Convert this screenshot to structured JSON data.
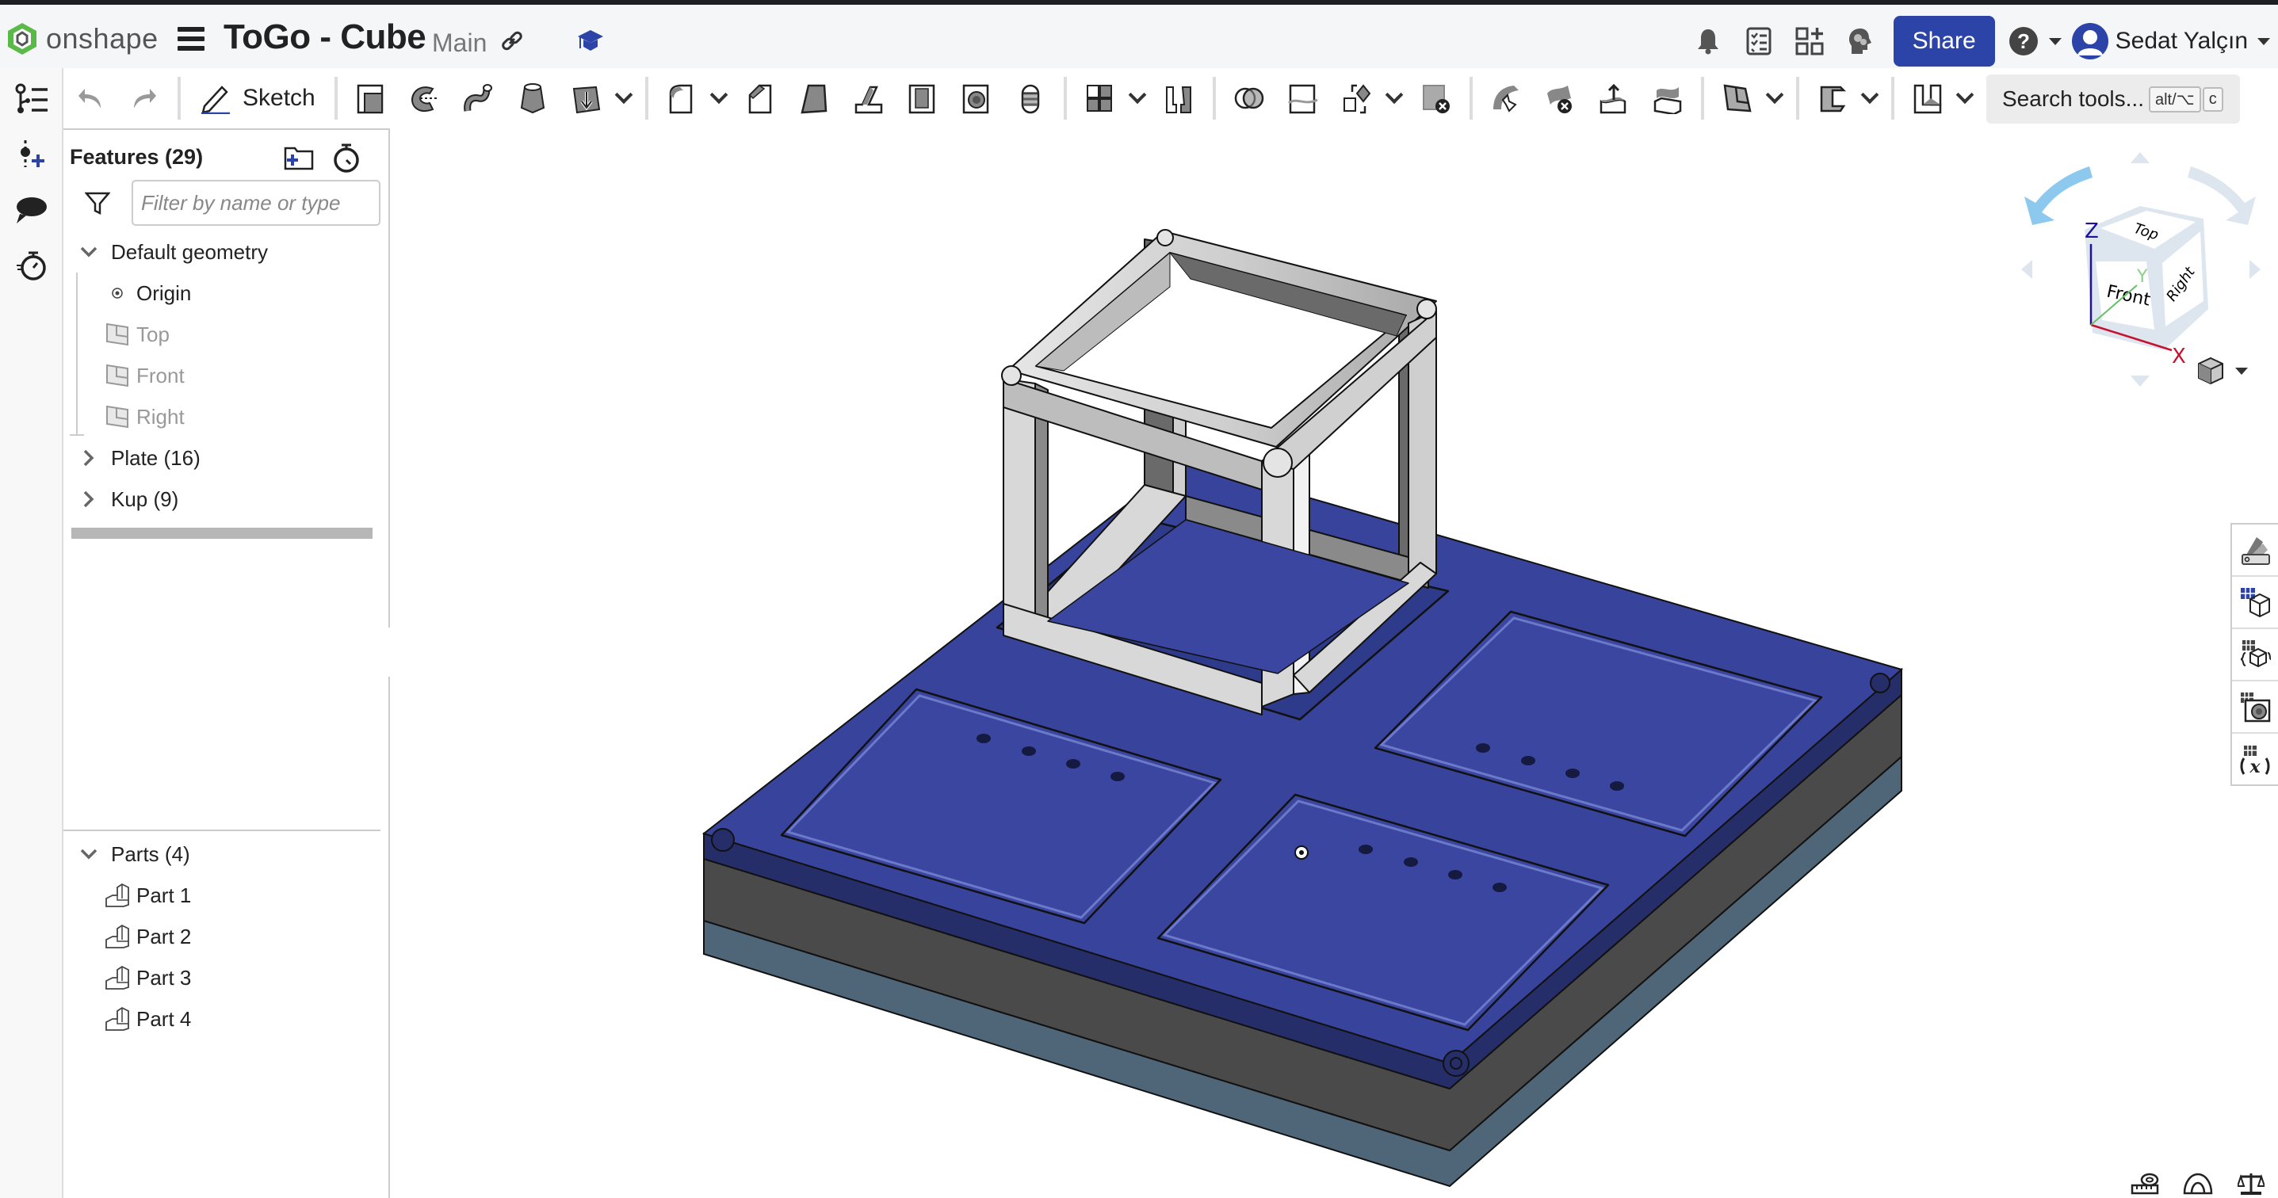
{
  "app": {
    "logo_text": "onshape",
    "doc_title": "ToGo - Cube",
    "branch": "Main"
  },
  "header": {
    "icons": [
      "link-icon",
      "education-icon",
      "notifications-icon",
      "tasks-icon",
      "app-store-icon",
      "learning-center-icon"
    ],
    "share_label": "Share",
    "help_icon": "help-icon",
    "user_name": "Sedat Yalçın"
  },
  "toolbar": {
    "sketch_label": "Sketch",
    "search_label": "Search tools...",
    "search_kbd_1": "alt/⌥",
    "search_kbd_2": "c",
    "tools": [
      "undo",
      "redo",
      "sketch",
      "extrude",
      "revolve",
      "sweep",
      "loft",
      "thicken",
      "fillet",
      "chamfer",
      "draft",
      "rib",
      "shell",
      "hole",
      "thread",
      "linear-pattern",
      "mirror",
      "boolean",
      "split",
      "transform",
      "delete-part",
      "move-face",
      "delete-face",
      "extend-surface",
      "offset-surface",
      "plane",
      "sheet-metal",
      "frame",
      "add-custom-feature"
    ]
  },
  "rail": {
    "items": [
      "feature-list",
      "insert-mate-connector",
      "comments",
      "performance"
    ]
  },
  "features_panel": {
    "title": "Features (29)",
    "filter_placeholder": "Filter by name or type",
    "tree": [
      {
        "label": "Default geometry",
        "expanded": true
      },
      {
        "label": "Origin",
        "child": true
      },
      {
        "label": "Top",
        "child": true,
        "hidden": true
      },
      {
        "label": "Front",
        "child": true,
        "hidden": true
      },
      {
        "label": "Right",
        "child": true,
        "hidden": true
      },
      {
        "label": "Plate (16)",
        "expanded": false
      },
      {
        "label": "Kup (9)",
        "expanded": false
      }
    ],
    "parts_title": "Parts (4)",
    "parts": [
      "Part 1",
      "Part 2",
      "Part 3",
      "Part 4"
    ]
  },
  "viewcube": {
    "faces": {
      "top": "Top",
      "front": "Front",
      "right": "Right"
    },
    "axes": {
      "x": "X",
      "y": "Y",
      "z": "Z"
    }
  },
  "right_dock": {
    "items": [
      "appearance-panel",
      "configurations-panel",
      "variable-studio-panel",
      "hole-table-panel",
      "variable-table-panel"
    ]
  },
  "measure_tools": [
    "measure-icon",
    "angle-icon",
    "mass-properties-icon"
  ],
  "colors": {
    "accent": "#2c44a8",
    "plate_top": "#38449c",
    "plate_side_dark": "#262e6a",
    "plate_mid": "#4a4a4a",
    "plate_bottom": "#4e6678",
    "cube_frame": "#d6d6d6"
  }
}
